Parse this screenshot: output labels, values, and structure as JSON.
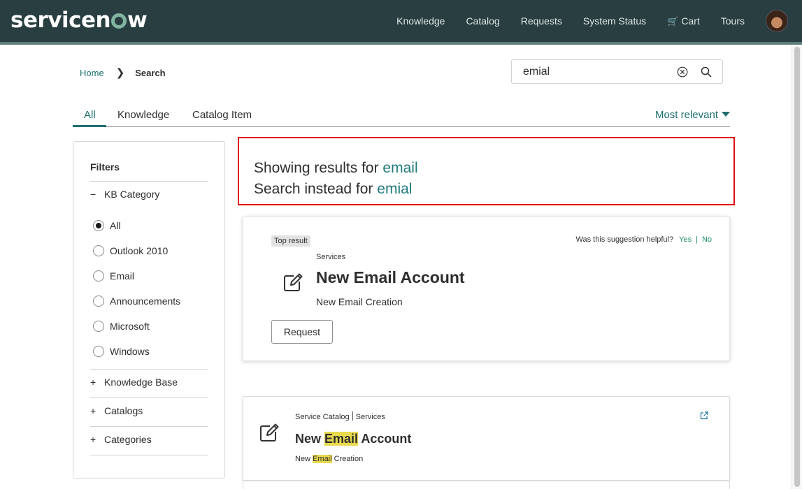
{
  "header": {
    "logo_text_a": "servicen",
    "logo_text_b": "w",
    "nav": [
      "Knowledge",
      "Catalog",
      "Requests",
      "System Status",
      "Cart",
      "Tours"
    ],
    "cart_icon": "shopping-cart-icon"
  },
  "breadcrumb": {
    "home": "Home",
    "current": "Search"
  },
  "search": {
    "value": "emial",
    "clear_icon": "clear-circle-icon",
    "search_icon": "magnifier-icon"
  },
  "tabs": {
    "all": "All",
    "knowledge": "Knowledge",
    "catalog_item": "Catalog Item",
    "sort": "Most relevant"
  },
  "filters": {
    "title": "Filters",
    "kb_category": "KB Category",
    "options": [
      "All",
      "Outlook 2010",
      "Email",
      "Announcements",
      "Microsoft",
      "Windows"
    ],
    "selected": "All",
    "knowledge_base": "Knowledge Base",
    "catalogs": "Catalogs",
    "categories": "Categories"
  },
  "suggestion": {
    "showing_prefix": "Showing results for ",
    "showing_term": "email",
    "instead_prefix": "Search instead for ",
    "instead_term": "emial"
  },
  "top_result": {
    "badge": "Top result",
    "helpful_question": "Was this suggestion helpful?",
    "yes": "Yes",
    "no": "No",
    "category": "Services",
    "title": "New Email Account",
    "description": "New Email Creation",
    "button": "Request"
  },
  "result_1": {
    "source": "Service Catalog",
    "category": "Services",
    "title_pre": "New ",
    "title_hl": "Email",
    "title_post": " Account",
    "desc_pre": "New ",
    "desc_hl": "Email",
    "desc_post": " Creation"
  },
  "colors": {
    "header_bg": "#293e40",
    "accent": "#1f6f6f",
    "highlight": "#e8d94f",
    "suggest_border": "#e20f12"
  }
}
